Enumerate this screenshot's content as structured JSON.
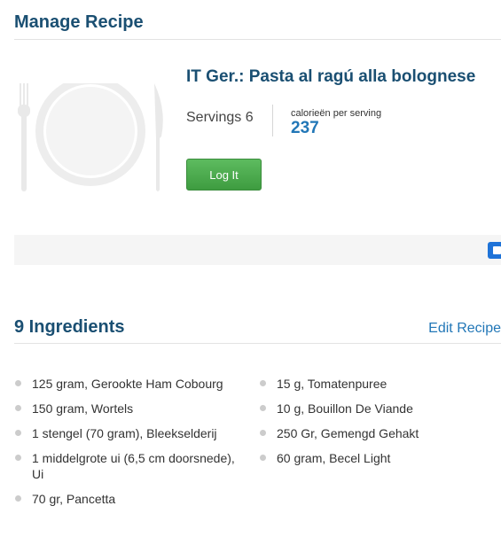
{
  "page": {
    "title": "Manage Recipe"
  },
  "recipe": {
    "name": "IT Ger.: Pasta al ragú alla bolognese",
    "servings_text": "Servings 6",
    "calories_label": "calorieën per serving",
    "calories_value": "237",
    "log_button_label": "Log It",
    "image_icon": "plate-fork-knife-icon"
  },
  "ingredients": {
    "heading": "9 Ingredients",
    "edit_link_label": "Edit Recipe",
    "left_column": [
      "125 gram, Gerookte Ham Cobourg",
      "150 gram, Wortels",
      "1 stengel (70 gram), Bleekselderij",
      "1 middelgrote ui (6,5 cm doorsnede), Ui",
      "70 gr, Pancetta"
    ],
    "right_column": [
      "15 g, Tomatenpuree",
      "10 g, Bouillon De Viande",
      "250 Gr, Gemengd Gehakt",
      "60 gram, Becel Light"
    ]
  },
  "colors": {
    "heading": "#1a4f72",
    "accent_blue": "#2277b7",
    "button_green": "#4caf50"
  }
}
